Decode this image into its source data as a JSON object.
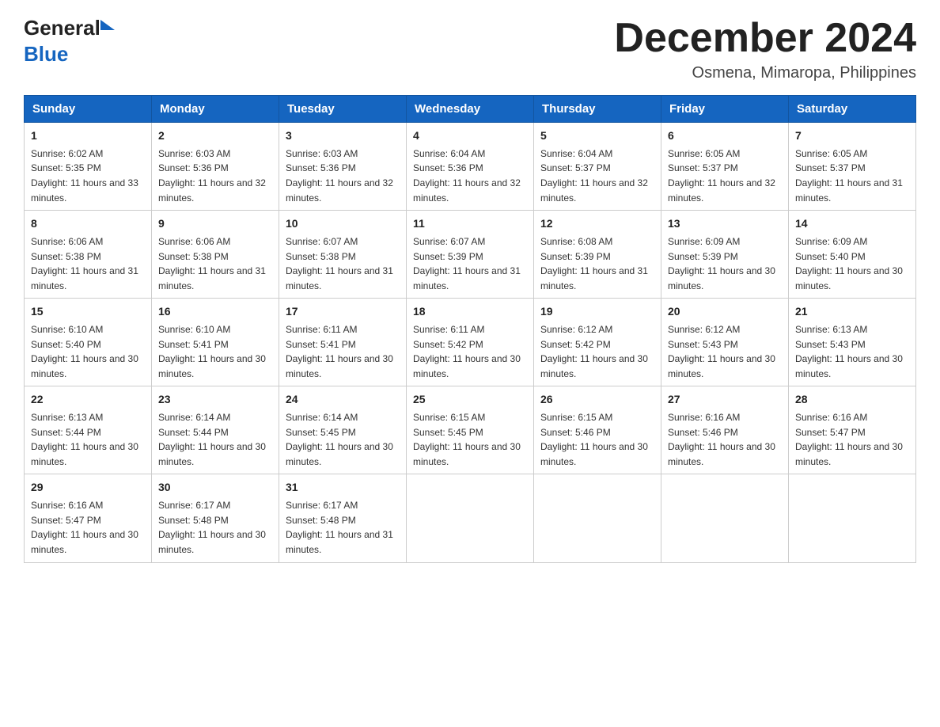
{
  "header": {
    "logo_general": "General",
    "logo_blue": "Blue",
    "month_title": "December 2024",
    "location": "Osmena, Mimaropa, Philippines"
  },
  "weekdays": [
    "Sunday",
    "Monday",
    "Tuesday",
    "Wednesday",
    "Thursday",
    "Friday",
    "Saturday"
  ],
  "weeks": [
    [
      {
        "day": "1",
        "sunrise": "6:02 AM",
        "sunset": "5:35 PM",
        "daylight": "11 hours and 33 minutes."
      },
      {
        "day": "2",
        "sunrise": "6:03 AM",
        "sunset": "5:36 PM",
        "daylight": "11 hours and 32 minutes."
      },
      {
        "day": "3",
        "sunrise": "6:03 AM",
        "sunset": "5:36 PM",
        "daylight": "11 hours and 32 minutes."
      },
      {
        "day": "4",
        "sunrise": "6:04 AM",
        "sunset": "5:36 PM",
        "daylight": "11 hours and 32 minutes."
      },
      {
        "day": "5",
        "sunrise": "6:04 AM",
        "sunset": "5:37 PM",
        "daylight": "11 hours and 32 minutes."
      },
      {
        "day": "6",
        "sunrise": "6:05 AM",
        "sunset": "5:37 PM",
        "daylight": "11 hours and 32 minutes."
      },
      {
        "day": "7",
        "sunrise": "6:05 AM",
        "sunset": "5:37 PM",
        "daylight": "11 hours and 31 minutes."
      }
    ],
    [
      {
        "day": "8",
        "sunrise": "6:06 AM",
        "sunset": "5:38 PM",
        "daylight": "11 hours and 31 minutes."
      },
      {
        "day": "9",
        "sunrise": "6:06 AM",
        "sunset": "5:38 PM",
        "daylight": "11 hours and 31 minutes."
      },
      {
        "day": "10",
        "sunrise": "6:07 AM",
        "sunset": "5:38 PM",
        "daylight": "11 hours and 31 minutes."
      },
      {
        "day": "11",
        "sunrise": "6:07 AM",
        "sunset": "5:39 PM",
        "daylight": "11 hours and 31 minutes."
      },
      {
        "day": "12",
        "sunrise": "6:08 AM",
        "sunset": "5:39 PM",
        "daylight": "11 hours and 31 minutes."
      },
      {
        "day": "13",
        "sunrise": "6:09 AM",
        "sunset": "5:39 PM",
        "daylight": "11 hours and 30 minutes."
      },
      {
        "day": "14",
        "sunrise": "6:09 AM",
        "sunset": "5:40 PM",
        "daylight": "11 hours and 30 minutes."
      }
    ],
    [
      {
        "day": "15",
        "sunrise": "6:10 AM",
        "sunset": "5:40 PM",
        "daylight": "11 hours and 30 minutes."
      },
      {
        "day": "16",
        "sunrise": "6:10 AM",
        "sunset": "5:41 PM",
        "daylight": "11 hours and 30 minutes."
      },
      {
        "day": "17",
        "sunrise": "6:11 AM",
        "sunset": "5:41 PM",
        "daylight": "11 hours and 30 minutes."
      },
      {
        "day": "18",
        "sunrise": "6:11 AM",
        "sunset": "5:42 PM",
        "daylight": "11 hours and 30 minutes."
      },
      {
        "day": "19",
        "sunrise": "6:12 AM",
        "sunset": "5:42 PM",
        "daylight": "11 hours and 30 minutes."
      },
      {
        "day": "20",
        "sunrise": "6:12 AM",
        "sunset": "5:43 PM",
        "daylight": "11 hours and 30 minutes."
      },
      {
        "day": "21",
        "sunrise": "6:13 AM",
        "sunset": "5:43 PM",
        "daylight": "11 hours and 30 minutes."
      }
    ],
    [
      {
        "day": "22",
        "sunrise": "6:13 AM",
        "sunset": "5:44 PM",
        "daylight": "11 hours and 30 minutes."
      },
      {
        "day": "23",
        "sunrise": "6:14 AM",
        "sunset": "5:44 PM",
        "daylight": "11 hours and 30 minutes."
      },
      {
        "day": "24",
        "sunrise": "6:14 AM",
        "sunset": "5:45 PM",
        "daylight": "11 hours and 30 minutes."
      },
      {
        "day": "25",
        "sunrise": "6:15 AM",
        "sunset": "5:45 PM",
        "daylight": "11 hours and 30 minutes."
      },
      {
        "day": "26",
        "sunrise": "6:15 AM",
        "sunset": "5:46 PM",
        "daylight": "11 hours and 30 minutes."
      },
      {
        "day": "27",
        "sunrise": "6:16 AM",
        "sunset": "5:46 PM",
        "daylight": "11 hours and 30 minutes."
      },
      {
        "day": "28",
        "sunrise": "6:16 AM",
        "sunset": "5:47 PM",
        "daylight": "11 hours and 30 minutes."
      }
    ],
    [
      {
        "day": "29",
        "sunrise": "6:16 AM",
        "sunset": "5:47 PM",
        "daylight": "11 hours and 30 minutes."
      },
      {
        "day": "30",
        "sunrise": "6:17 AM",
        "sunset": "5:48 PM",
        "daylight": "11 hours and 30 minutes."
      },
      {
        "day": "31",
        "sunrise": "6:17 AM",
        "sunset": "5:48 PM",
        "daylight": "11 hours and 31 minutes."
      },
      null,
      null,
      null,
      null
    ]
  ]
}
